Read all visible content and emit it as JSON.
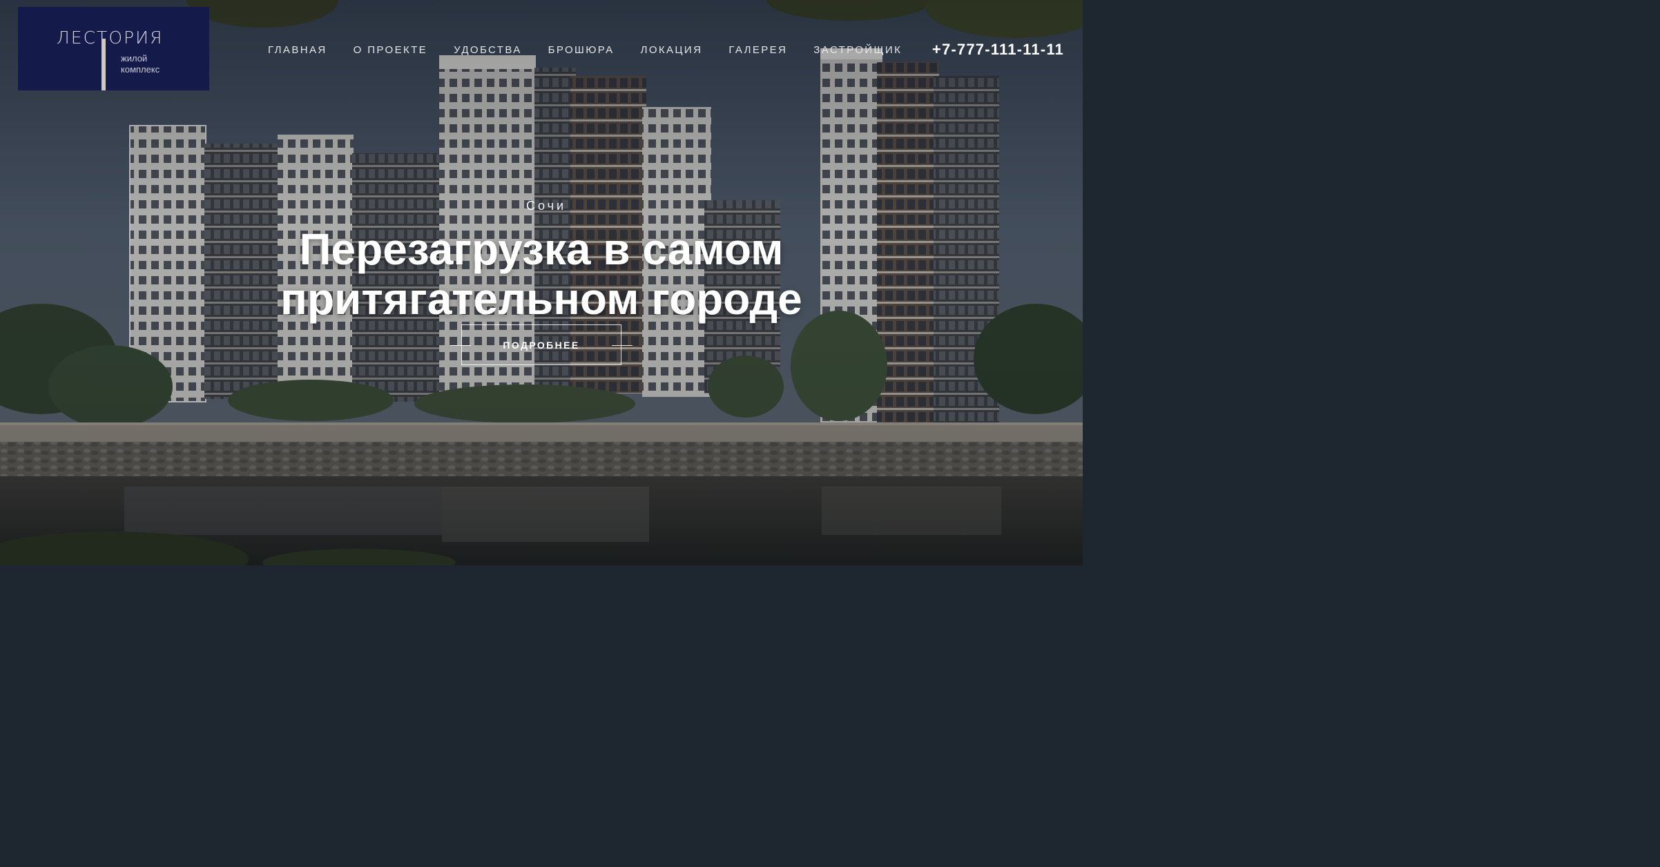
{
  "logo": {
    "title": "ЛЕСТОРИЯ",
    "subtitle_line1": "жилой",
    "subtitle_line2": "комплекс"
  },
  "nav": {
    "items": [
      {
        "label": "ГЛАВНАЯ"
      },
      {
        "label": "О ПРОЕКТЕ"
      },
      {
        "label": "УДОБСТВА"
      },
      {
        "label": "БРОШЮРА"
      },
      {
        "label": "ЛОКАЦИЯ"
      },
      {
        "label": "ГАЛЕРЕЯ"
      },
      {
        "label": "ЗАСТРОЙЩИК"
      }
    ],
    "phone": "+7-777-111-11-11"
  },
  "hero": {
    "city": "Сочи",
    "title_line1": "Перезагрузка в самом",
    "title_line2": "притягательном городе",
    "button_label": "ПОДРОБНЕЕ"
  },
  "colors": {
    "logo_background": "#141a4a",
    "text": "#ffffff"
  }
}
